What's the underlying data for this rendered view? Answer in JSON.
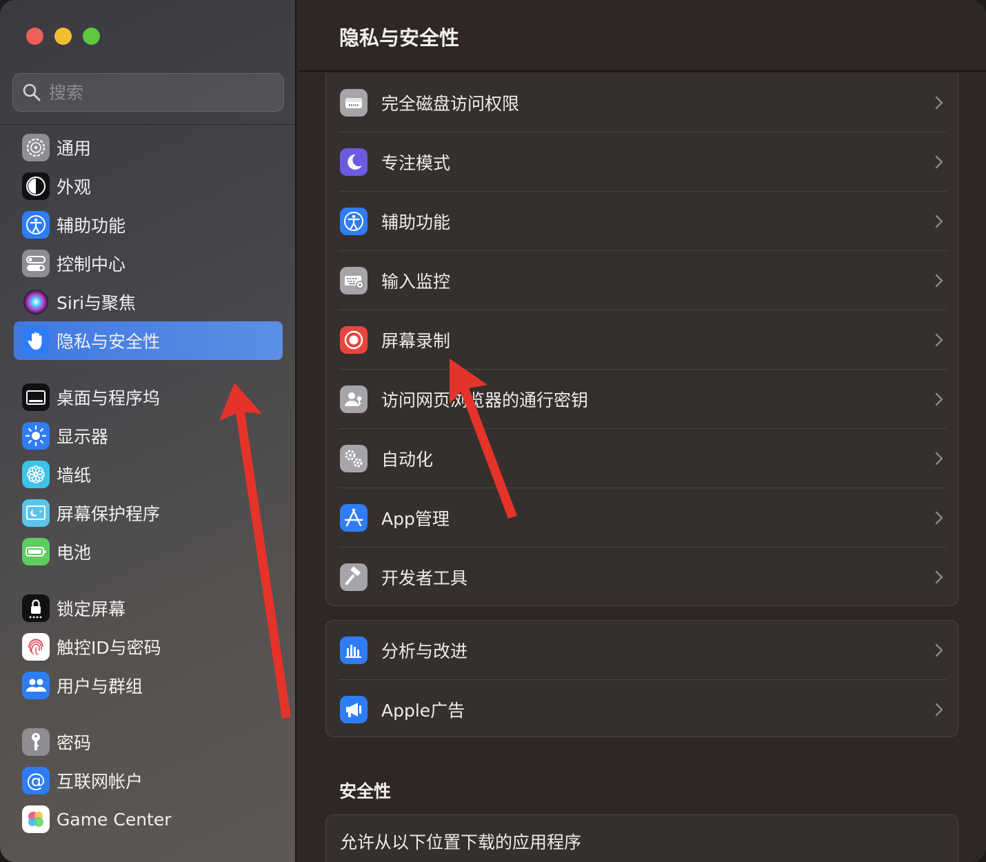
{
  "window": {
    "traffic_lights": [
      "close",
      "minimize",
      "zoom"
    ]
  },
  "sidebar": {
    "search_placeholder": "搜索",
    "items": [
      {
        "label": "通用",
        "icon": "gear-icon"
      },
      {
        "label": "外观",
        "icon": "appearance-icon"
      },
      {
        "label": "辅助功能",
        "icon": "accessibility-icon"
      },
      {
        "label": "控制中心",
        "icon": "control-center-icon"
      },
      {
        "label": "Siri与聚焦",
        "icon": "siri-icon"
      },
      {
        "label": "隐私与安全性",
        "icon": "hand-icon",
        "selected": true
      },
      {
        "label": "桌面与程序坞",
        "icon": "dock-icon"
      },
      {
        "label": "显示器",
        "icon": "sun-icon"
      },
      {
        "label": "墙纸",
        "icon": "flower-icon"
      },
      {
        "label": "屏幕保护程序",
        "icon": "screensaver-icon"
      },
      {
        "label": "电池",
        "icon": "battery-icon"
      },
      {
        "label": "锁定屏幕",
        "icon": "lock-icon"
      },
      {
        "label": "触控ID与密码",
        "icon": "fingerprint-icon"
      },
      {
        "label": "用户与群组",
        "icon": "users-icon"
      },
      {
        "label": "密码",
        "icon": "key-icon"
      },
      {
        "label": "互联网帐户",
        "icon": "at-icon"
      },
      {
        "label": "Game Center",
        "icon": "game-center-icon"
      }
    ]
  },
  "main": {
    "title": "隐私与安全性",
    "group1": [
      {
        "label": "完全磁盘访问权限",
        "icon": "disk-icon"
      },
      {
        "label": "专注模式",
        "icon": "moon-icon"
      },
      {
        "label": "辅助功能",
        "icon": "accessibility-icon"
      },
      {
        "label": "输入监控",
        "icon": "keyboard-icon"
      },
      {
        "label": "屏幕录制",
        "icon": "record-icon"
      },
      {
        "label": "访问网页浏览器的通行密钥",
        "icon": "person-key-icon"
      },
      {
        "label": "自动化",
        "icon": "gears-icon"
      },
      {
        "label": "App管理",
        "icon": "app-store-icon"
      },
      {
        "label": "开发者工具",
        "icon": "hammer-icon"
      }
    ],
    "group2": [
      {
        "label": "分析与改进",
        "icon": "chart-icon"
      },
      {
        "label": "Apple广告",
        "icon": "megaphone-icon"
      }
    ],
    "security_title": "安全性",
    "allow_downloads_label": "允许从以下位置下载的应用程序"
  },
  "colors": {
    "selection": "#4a7fdc",
    "annotation_arrow": "#e6332a"
  }
}
